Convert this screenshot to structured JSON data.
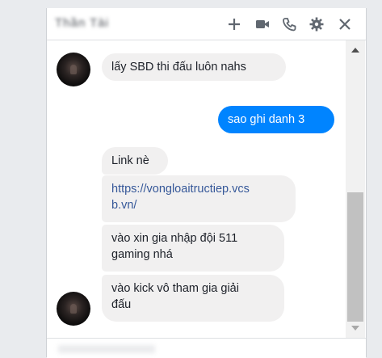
{
  "chat": {
    "title": "Thần Tài",
    "header_icons": [
      "plus-icon",
      "video-icon",
      "phone-icon",
      "gear-icon",
      "close-icon"
    ]
  },
  "messages": [
    {
      "from": "other",
      "text": "lấy SBD thi đấu luôn nahs"
    },
    {
      "from": "me",
      "text": "sao ghi danh 3"
    },
    {
      "from": "other",
      "text": "Link nè"
    },
    {
      "from": "other",
      "text": "https://vongloaitructiep.vcsb.vn/",
      "line1": "https://vongloaitructiep.vcs",
      "line2": "b.vn/"
    },
    {
      "from": "other",
      "line1": "vào xin gia nhập đội 511",
      "line2": "gaming nhá"
    },
    {
      "from": "other",
      "line1": "vào kick vô tham gia giải",
      "line2": "đấu"
    }
  ],
  "colors": {
    "accent": "#0084ff",
    "bubble_other": "#f1f0f0",
    "link": "#365899"
  }
}
